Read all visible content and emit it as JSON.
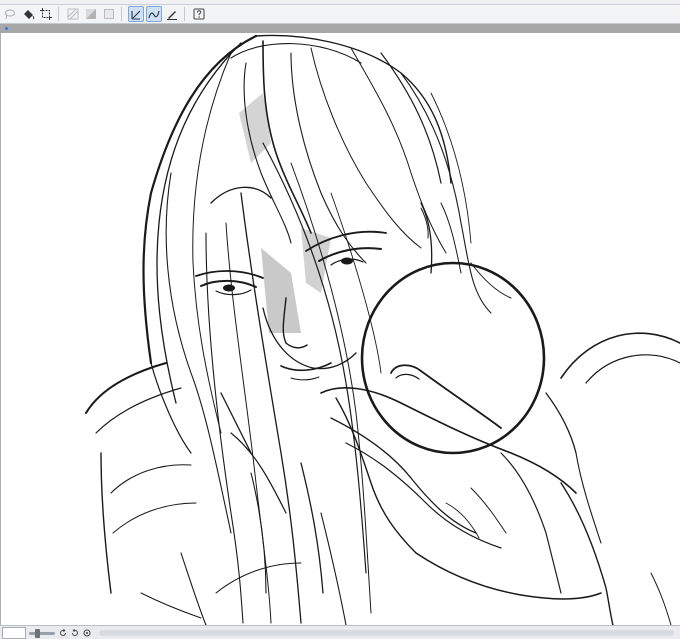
{
  "toolbar": {
    "tools": [
      {
        "icon": "lasso-fill-icon"
      },
      {
        "icon": "bucket-fill-icon"
      },
      {
        "icon": "crop-select-icon"
      },
      {
        "icon": "hatch-pattern-icon"
      },
      {
        "icon": "gradient-icon"
      },
      {
        "icon": "square-icon"
      },
      {
        "icon": "line-tool-icon",
        "active": true
      },
      {
        "icon": "curve-tool-icon",
        "active": true
      },
      {
        "icon": "pen-correction-icon"
      },
      {
        "icon": "help-icon"
      }
    ]
  },
  "colors": {
    "frame": "#a7a7a7",
    "accent": "#3a7bd5",
    "line": "#1a1a1a",
    "shadow_tone": "#c9c9c9"
  },
  "status": {
    "zoom_level": 0.3
  }
}
